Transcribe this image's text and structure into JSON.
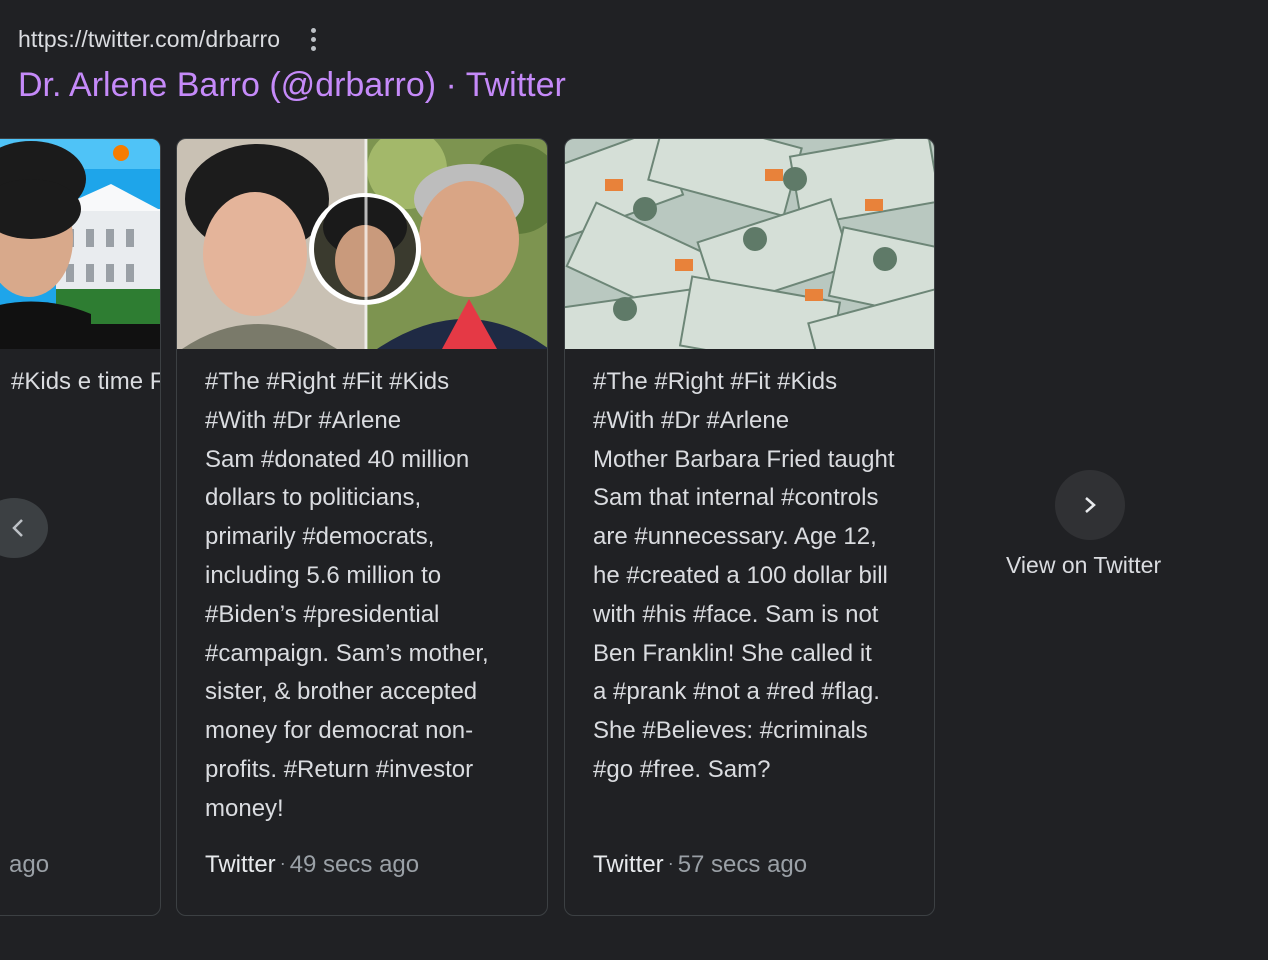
{
  "result": {
    "url": "https://twitter.com/drbarro",
    "title": "Dr. Arlene Barro (@drbarro) · Twitter"
  },
  "cards": [
    {
      "text": "#Kids\ne\ntime FTX\nvored\npromoted\nn #met with\ns at the\nBahamas,\nm used\n to #buy\nerty.",
      "source": "",
      "time": "ago"
    },
    {
      "text": "#The #Right #Fit #Kids\n#With #Dr #Arlene\nSam #donated 40 million\ndollars to politicians,\nprimarily #democrats,\nincluding 5.6 million to\n#Biden’s #presidential\n#campaign. Sam’s mother,\nsister, & brother accepted\nmoney for democrat non-\nprofits. #Return #investor\nmoney!",
      "source": "Twitter",
      "time": "49 secs ago"
    },
    {
      "text": "#The #Right #Fit #Kids\n#With #Dr #Arlene\nMother Barbara Fried taught\nSam that internal #controls\nare #unnecessary. Age 12,\nhe #created a 100 dollar bill\nwith #his #face. Sam is not\nBen Franklin! She called it\na #prank #not a #red #flag.\nShe #Believes: #criminals\n#go #free. Sam?",
      "source": "Twitter",
      "time": "57 secs ago"
    }
  ],
  "view_on": "View on Twitter",
  "icons": {
    "more": "more-vert-icon",
    "prev": "chevron-left-icon",
    "next": "chevron-right-icon"
  }
}
